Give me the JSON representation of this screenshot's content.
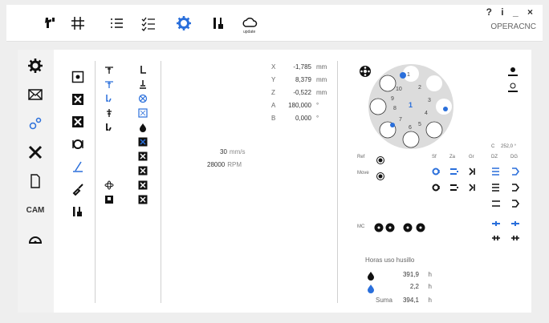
{
  "window": {
    "controls": "? i _ ×",
    "name": "OPERACNC"
  },
  "topbar": {
    "update_label": "update"
  },
  "leftbar": {
    "cam_label": "CAM"
  },
  "coords": [
    {
      "axis": "X",
      "value": "-1,785",
      "unit": "mm"
    },
    {
      "axis": "Y",
      "value": "8,379",
      "unit": "mm"
    },
    {
      "axis": "Z",
      "value": "-0,522",
      "unit": "mm"
    },
    {
      "axis": "A",
      "value": "180,000",
      "unit": "°"
    },
    {
      "axis": "B",
      "value": "0,000",
      "unit": "°"
    }
  ],
  "spindle": {
    "feed": "30",
    "feed_unit": "mm/s",
    "rpm": "28000",
    "rpm_unit": "RPM"
  },
  "tool_changer": {
    "positions": [
      "1",
      "2",
      "3",
      "4",
      "5",
      "6",
      "7",
      "8",
      "9",
      "10"
    ],
    "active": "1",
    "ref_label": "Ref",
    "move_label": "Move",
    "c_label": "C",
    "c_value": "252,0 °",
    "col_headers": [
      "Sf",
      "Za",
      "Gr",
      "DZ",
      "DG"
    ],
    "mc_label": "MC"
  },
  "hours": {
    "title": "Horas uso husillo",
    "row1_value": "391,9",
    "row1_unit": "h",
    "row2_value": "2,2",
    "row2_unit": "h",
    "sum_label": "Suma",
    "sum_value": "394,1",
    "sum_unit": "h"
  },
  "colors": {
    "accent": "#2a6fdb",
    "black": "#111111",
    "panel": "#ffffff",
    "background": "#eeeeee"
  },
  "icons": {
    "topbar": [
      "spindle-icon",
      "axes-icon",
      "list-icon",
      "checklist-icon",
      "settings-gear-icon",
      "tools-icon",
      "cloud-update-icon"
    ],
    "leftbar": [
      "gear-icon",
      "envelope-icon",
      "gears-icon",
      "tools-cross-icon",
      "document-icon",
      "cam-icon",
      "protractor-icon"
    ]
  }
}
